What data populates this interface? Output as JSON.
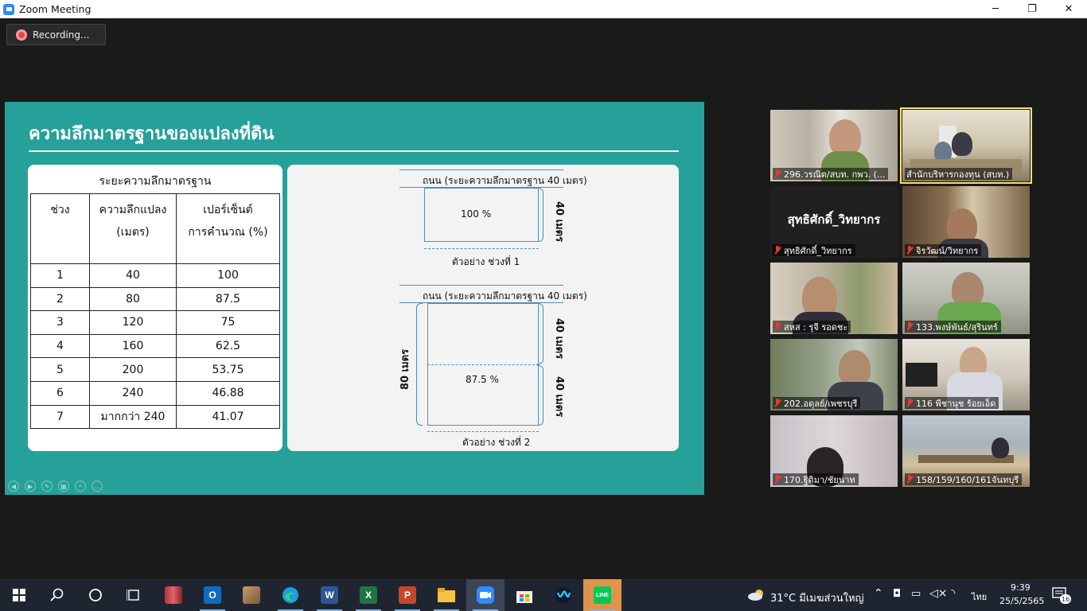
{
  "window": {
    "title": "Zoom Meeting",
    "minimize": "─",
    "restore": "❐",
    "close": "✕"
  },
  "recording": {
    "label": "Recording..."
  },
  "slide": {
    "title": "ความลึกมาตรฐานของแปลงที่ดิน",
    "table": {
      "caption": "ระยะความลึกมาตรฐาน",
      "headers": [
        "ช่วง",
        "ความลึกแปลง\n(เมตร)",
        "เปอร์เซ็นต์\nการคำนวณ (%)"
      ],
      "rows": [
        [
          "1",
          "40",
          "100"
        ],
        [
          "2",
          "80",
          "87.5"
        ],
        [
          "3",
          "120",
          "75"
        ],
        [
          "4",
          "160",
          "62.5"
        ],
        [
          "5",
          "200",
          "53.75"
        ],
        [
          "6",
          "240",
          "46.88"
        ],
        [
          "7",
          "มากกว่า 240",
          "41.07"
        ]
      ]
    },
    "diagram": {
      "road_label_1": "ถนน (ระยะความลึกมาตรฐาน 40 เมตร)",
      "box1_percent": "100 %",
      "depth_40_a": "40 เมตร",
      "example_1": "ตัวอย่าง ช่วงที่ 1",
      "road_label_2": "ถนน (ระยะความลึกมาตรฐาน 40 เมตร)",
      "depth_40_b": "40 เมตร",
      "depth_80": "80 เมตร",
      "box2_percent": "87.5 %",
      "depth_40_c": "40 เมตร",
      "example_2": "ตัวอย่าง ช่วงที่ 2"
    }
  },
  "participants": [
    {
      "name": "296.วรณิต/สบท. กพว. (...",
      "muted": true
    },
    {
      "name": "สำนักบริหารกองทุน (สบท.)",
      "muted": false,
      "active": true
    },
    {
      "name": "สุทธิศักดิ์_วิทยากร",
      "muted": true,
      "display_name": "สุทธิศักดิ์_วิทยากร",
      "video_off": true
    },
    {
      "name": "จิรวัฒน์/วิทยากร",
      "muted": true
    },
    {
      "name": "สหส : รุจี รอดชะ",
      "muted": true
    },
    {
      "name": "133.พงษ์พันธ์/สุรินทร์",
      "muted": true
    },
    {
      "name": "202.อดุลย์/เพชรบุรี",
      "muted": true
    },
    {
      "name": "116 พีชานุช ร้อยเอ็ด",
      "muted": true
    },
    {
      "name": "170.ฐิติมา/ชัยนาท",
      "muted": true
    },
    {
      "name": "158/159/160/161จันทบุรี",
      "muted": true
    }
  ],
  "taskbar": {
    "icons": [
      "windows-start",
      "search",
      "cortana",
      "task-view",
      "winrar",
      "outlook",
      "paint-tool",
      "edge",
      "word",
      "excel",
      "powerpoint",
      "file-explorer",
      "zoom",
      "microsoft-store",
      "webex",
      "line"
    ],
    "word_letter": "W",
    "excel_letter": "X",
    "ppt_letter": "P",
    "outlook_letter": "O",
    "line_label": "LINE",
    "weather": "31°C มีเมฆส่วนใหญ่",
    "language": "ไทย",
    "time": "9:39",
    "date": "25/5/2565",
    "notifications": "16"
  }
}
